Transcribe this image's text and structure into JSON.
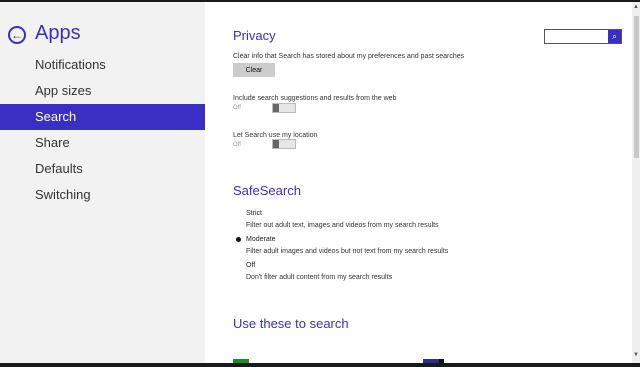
{
  "sidebar": {
    "title": "Apps",
    "back_icon": "arrow-left-circle-icon",
    "items": [
      {
        "label": "Notifications",
        "active": false
      },
      {
        "label": "App sizes",
        "active": false
      },
      {
        "label": "Search",
        "active": true
      },
      {
        "label": "Share",
        "active": false
      },
      {
        "label": "Defaults",
        "active": false
      },
      {
        "label": "Switching",
        "active": false
      }
    ]
  },
  "search": {
    "placeholder": "",
    "icon": "search-icon",
    "icon_glyph": "⌕"
  },
  "privacy": {
    "title": "Privacy",
    "clear_desc": "Clear info that Search has stored about my preferences and past searches",
    "clear_label": "Clear",
    "suggestions_label": "Include search suggestions and results from the web",
    "suggestions_state": "Off",
    "location_label": "Let Search use my location",
    "location_state": "Off"
  },
  "safesearch": {
    "title": "SafeSearch",
    "selected": "Moderate",
    "options": [
      {
        "label": "Strict",
        "desc": "Filter out adult text, images and videos from my search results"
      },
      {
        "label": "Moderate",
        "desc": "Filter adult images and videos but not text from my search results"
      },
      {
        "label": "Off",
        "desc": "Don't filter adult content from my search results"
      }
    ]
  },
  "use_these": {
    "title": "Use these to search"
  },
  "colors": {
    "accent": "#3a2fc2",
    "sidebar_bg": "#f2f2f2",
    "tile_green": "#1e8a2e",
    "tile_blue": "#2d2a9c"
  }
}
